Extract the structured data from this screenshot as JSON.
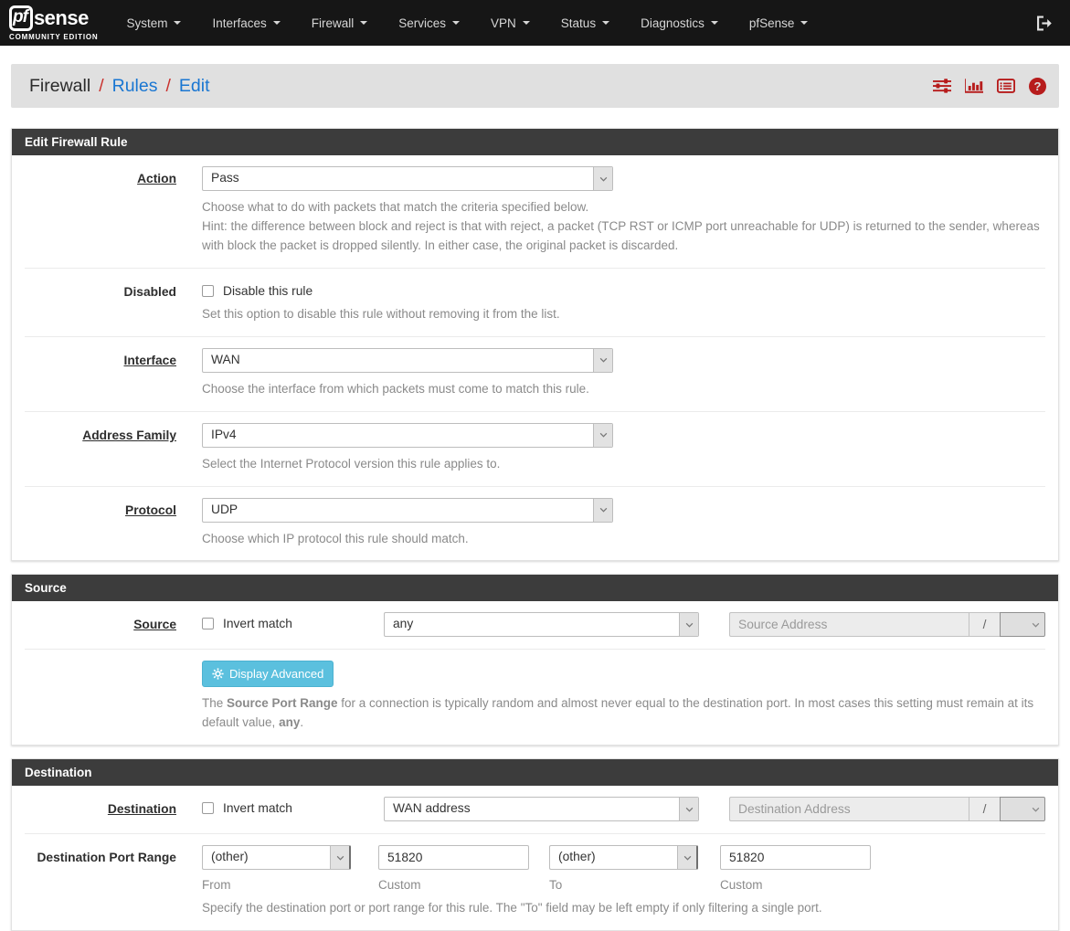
{
  "navbar": {
    "logo": {
      "prefix": "pf",
      "suffix": "sense",
      "tagline": "COMMUNITY EDITION"
    },
    "items": [
      {
        "label": "System"
      },
      {
        "label": "Interfaces"
      },
      {
        "label": "Firewall"
      },
      {
        "label": "Services"
      },
      {
        "label": "VPN"
      },
      {
        "label": "Status"
      },
      {
        "label": "Diagnostics"
      },
      {
        "label": "pfSense"
      }
    ],
    "logout_icon": "sign-out-icon"
  },
  "breadcrumb": {
    "section": "Firewall",
    "separator": "/",
    "page": "Rules",
    "subpage": "Edit",
    "icons": [
      "sliders-icon",
      "bar-chart-icon",
      "list-icon",
      "help-icon"
    ],
    "help_glyph": "?"
  },
  "panels": {
    "rule": {
      "title": "Edit Firewall Rule",
      "action": {
        "label": "Action",
        "value": "Pass",
        "help_line1": "Choose what to do with packets that match the criteria specified below.",
        "help_line2": "Hint: the difference between block and reject is that with reject, a packet (TCP RST or ICMP port unreachable for UDP) is returned to the sender, whereas with block the packet is dropped silently. In either case, the original packet is discarded."
      },
      "disabled": {
        "label": "Disabled",
        "checkbox_label": "Disable this rule",
        "checked": false,
        "help": "Set this option to disable this rule without removing it from the list."
      },
      "interface": {
        "label": "Interface",
        "value": "WAN",
        "help": "Choose the interface from which packets must come to match this rule."
      },
      "address_family": {
        "label": "Address Family",
        "value": "IPv4",
        "help": "Select the Internet Protocol version this rule applies to."
      },
      "protocol": {
        "label": "Protocol",
        "value": "UDP",
        "help": "Choose which IP protocol this rule should match."
      }
    },
    "source": {
      "title": "Source",
      "row": {
        "label": "Source",
        "invert_label": "Invert match",
        "invert_checked": false,
        "value": "any",
        "address_placeholder": "Source Address",
        "mask_separator": "/"
      },
      "advanced_button": "Display Advanced",
      "help": {
        "pre": "The ",
        "bold1": "Source Port Range",
        "mid": " for a connection is typically random and almost never equal to the destination port. In most cases this setting must remain at its default value, ",
        "bold2": "any",
        "post": "."
      }
    },
    "destination": {
      "title": "Destination",
      "row": {
        "label": "Destination",
        "invert_label": "Invert match",
        "invert_checked": false,
        "value": "WAN address",
        "address_placeholder": "Destination Address",
        "mask_separator": "/"
      },
      "port_range": {
        "label": "Destination Port Range",
        "from": {
          "value": "(other)",
          "caption": "From"
        },
        "from_custom": {
          "value": "51820",
          "caption": "Custom"
        },
        "to": {
          "value": "(other)",
          "caption": "To"
        },
        "to_custom": {
          "value": "51820",
          "caption": "Custom"
        },
        "help": "Specify the destination port or port range for this rule. The \"To\" field may be left empty if only filtering a single port."
      }
    }
  },
  "colors": {
    "navbar_bg": "#161616",
    "breadcrumb_bg": "#e0e0e0",
    "link_blue": "#1976d2",
    "separator_red": "#c9302c",
    "brand_icon_red": "#b71c1c",
    "panel_header_bg": "#3c3c3c",
    "info_button": "#5bc0de",
    "help_text": "#8a8a8a"
  }
}
